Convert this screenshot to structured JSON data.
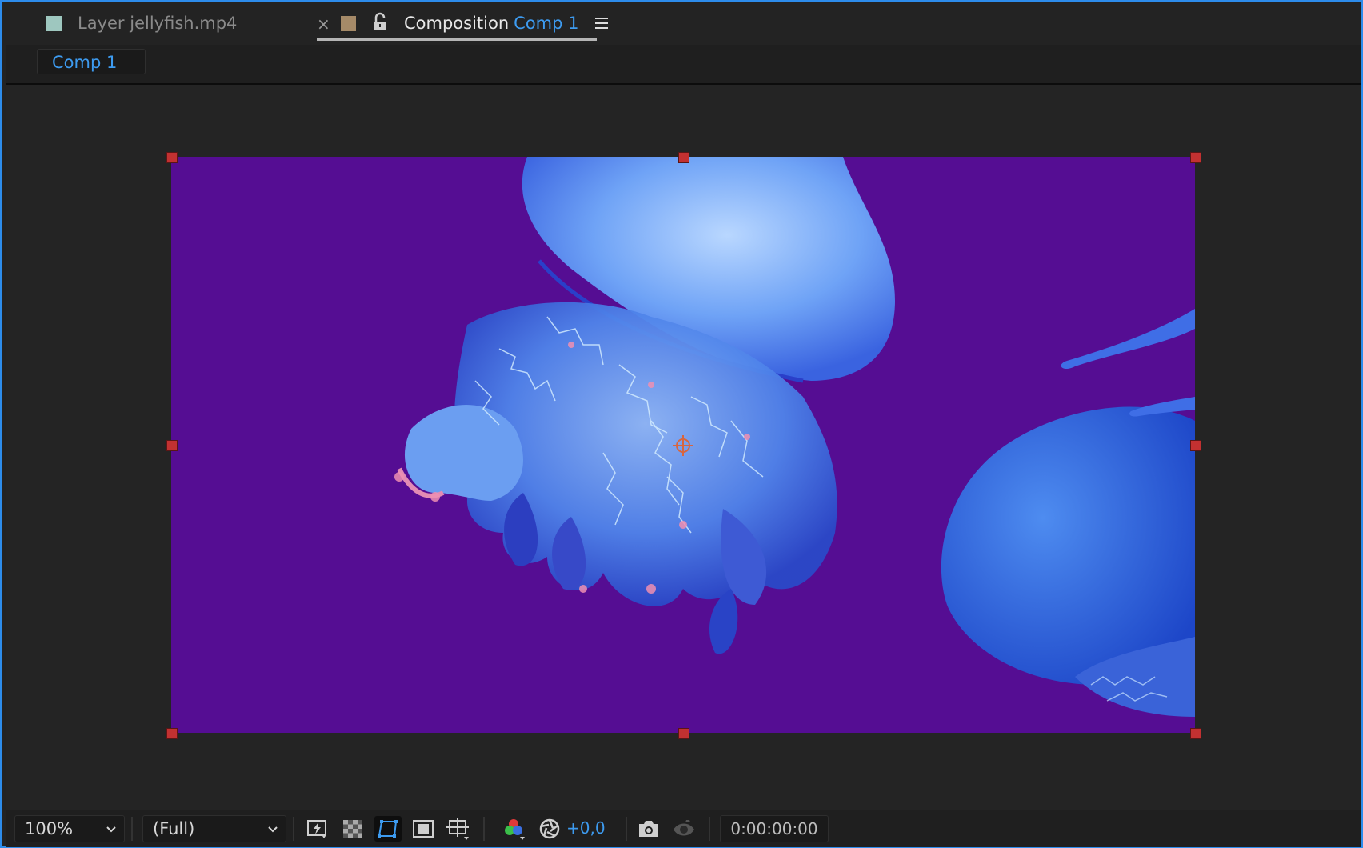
{
  "tabs": {
    "layer": {
      "prefix": "Layer",
      "name": "jellyfish.mp4"
    },
    "close_symbol": "×",
    "composition": {
      "prefix": "Composition",
      "name": "Comp 1"
    }
  },
  "breadcrumb": {
    "label": "Comp 1"
  },
  "viewer": {
    "background_color": "#550d93",
    "content": "jellyfish video frame"
  },
  "toolbar": {
    "magnification": "100%",
    "resolution": "(Full)",
    "exposure": "+0,0",
    "timecode": "0:00:00:00",
    "buttons": [
      "fast-previews-icon",
      "transparency-grid-icon",
      "mask-path-visibility-icon",
      "region-of-interest-icon",
      "grid-guides-icon",
      "show-channel-icon",
      "reset-exposure-icon",
      "snapshot-icon",
      "show-snapshot-icon"
    ]
  },
  "colors": {
    "accent": "#2d8ceb",
    "link_blue": "#3d9bf0",
    "handle_red": "#c23131"
  }
}
